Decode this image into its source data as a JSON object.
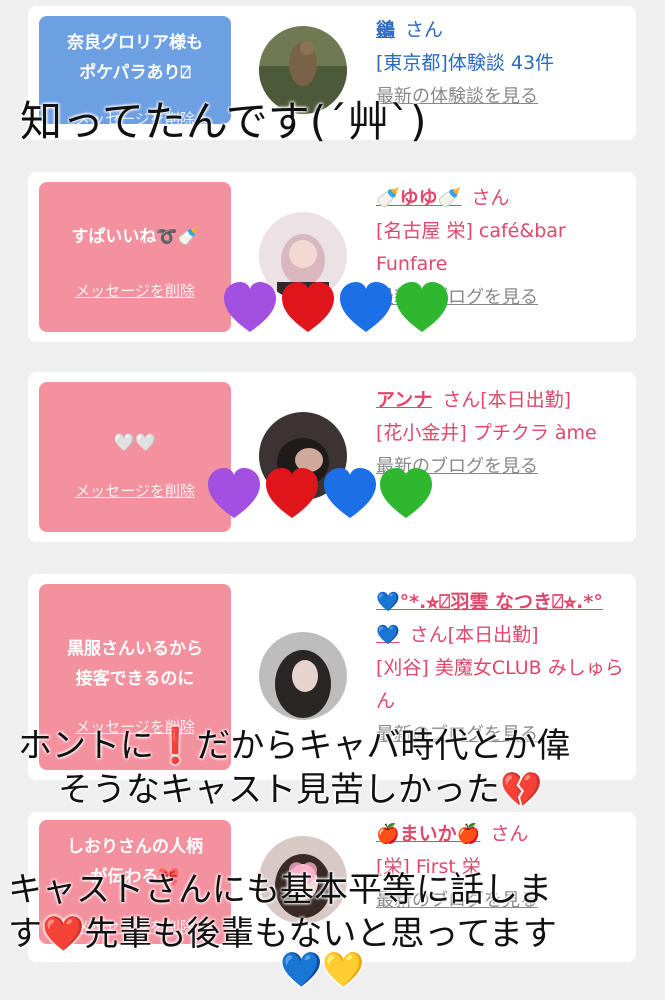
{
  "cards": [
    {
      "message": "奈良グロリア様も\nポケパラあり⍁",
      "delete_label": "メッセージを削除",
      "name": "鶲",
      "san": "さん",
      "info": "[東京都]体験談 43件",
      "link": "最新の体験談を見る",
      "accent": "#2a6bbf"
    },
    {
      "message": "すぱいいね➰🍼",
      "delete_label": "メッセージを削除",
      "name": "🍼ゆゆ🍼",
      "san": "さん",
      "info": "[名古屋 栄] café&bar Funfare",
      "link": "最新のブログを見る",
      "accent": "#e0476a"
    },
    {
      "message": "🤍🤍",
      "delete_label": "メッセージを削除",
      "name": "アンナ",
      "san": "さん[本日出勤]",
      "info": "[花小金井] プチクラ àme",
      "link": "最新のブログを見る",
      "accent": "#e0476a"
    },
    {
      "message": "黒服さんいるから\n接客できるのに",
      "delete_label": "メッセージを削除",
      "name": "💙°*.⭐︎⍁羽雲 なつき⍁⭐︎.*°💙",
      "san": "さん[本日出勤]",
      "info": "[刈谷] 美魔女CLUB みしゅらん",
      "link": "最新のブログを見る",
      "accent": "#e0476a"
    },
    {
      "message": "しおりさんの人柄\nが伝わる🎀",
      "delete_label": "メッセージを削除",
      "name": "🍎まいか🍎",
      "san": "さん",
      "info": "[栄] First 栄",
      "link": "最新のブログを見る",
      "accent": "#e0476a"
    }
  ],
  "overlays": {
    "top": "知ってたんです(´艸`)",
    "middle_1": "ホントに❗️だからキャバ時代とか偉",
    "middle_2": "そうなキャスト見苦しかった💔",
    "bottom_1": "キャストさんにも基本平等に話しま",
    "bottom_2": "す❤️先輩も後輩もないと思ってます",
    "bottom_3": "💙💛"
  },
  "colors": {
    "bubble_pink": "#f4919f",
    "bubble_blue": "#6d9fe3",
    "background": "#efefef"
  }
}
